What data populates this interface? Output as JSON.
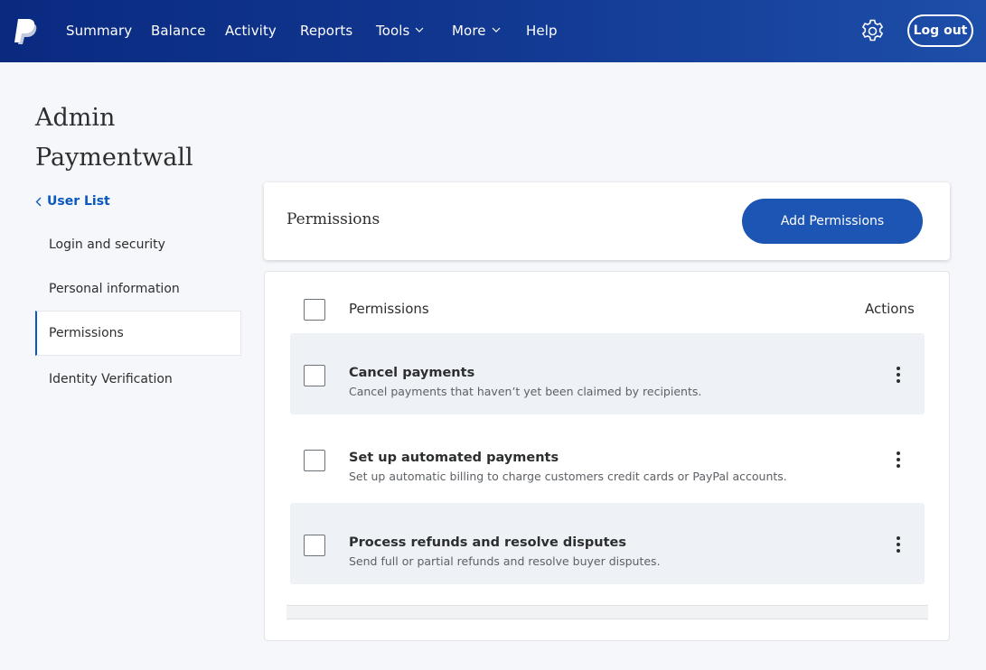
{
  "brand": {
    "logo": "paypal-logo"
  },
  "nav": {
    "items": [
      {
        "label": "Summary"
      },
      {
        "label": "Balance"
      },
      {
        "label": "Activity"
      },
      {
        "label": "Reports"
      },
      {
        "label": "Tools",
        "dropdown": true
      },
      {
        "label": "More",
        "dropdown": true
      },
      {
        "label": "Help"
      }
    ],
    "settings_icon": "gear-icon",
    "logout_label": "Log out"
  },
  "account": {
    "title_line1": "Admin",
    "title_line2": "Paymentwall"
  },
  "sidebar": {
    "back_label": "User List",
    "items": [
      {
        "label": "Login and security",
        "active": false
      },
      {
        "label": "Personal information",
        "active": false
      },
      {
        "label": "Permissions",
        "active": true
      },
      {
        "label": "Identity Verification",
        "active": false
      }
    ]
  },
  "permissions_header": {
    "title": "Permissions",
    "add_button_label": "Add Permissions"
  },
  "table": {
    "header_permissions": "Permissions",
    "header_actions": "Actions",
    "rows": [
      {
        "title": "Cancel payments",
        "description": "Cancel payments that haven’t yet been claimed by recipients."
      },
      {
        "title": "Set up automated payments",
        "description": "Set up automatic billing to charge customers credit cards or PayPal accounts."
      },
      {
        "title": "Process refunds and resolve disputes",
        "description": "Send full or partial refunds and resolve buyer disputes."
      }
    ]
  },
  "colors": {
    "header_gradient_start": "#0a2a80",
    "header_gradient_end": "#1d4ea9",
    "accent": "#1c55b3",
    "link": "#0a57bd",
    "row_shade": "#eef2f7"
  }
}
